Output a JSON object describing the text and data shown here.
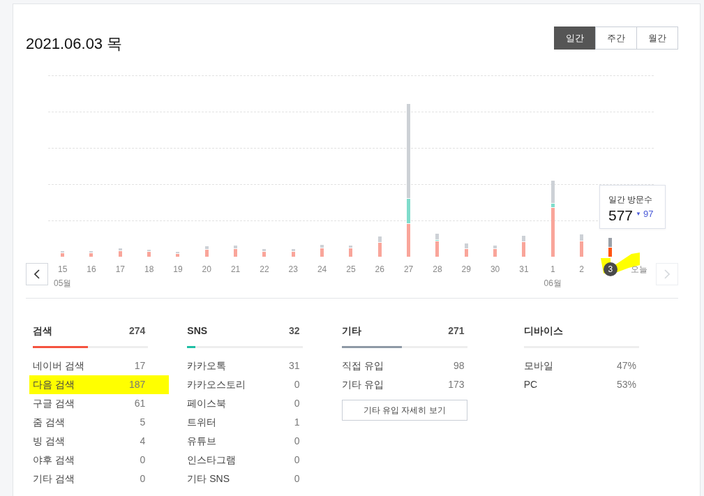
{
  "date_title": "2021.06.03 목",
  "period_tabs": [
    {
      "label": "일간",
      "selected": true
    },
    {
      "label": "주간",
      "selected": false
    },
    {
      "label": "월간",
      "selected": false
    }
  ],
  "chart": {
    "prev": {
      "disabled": false
    },
    "next": {
      "disabled": true
    },
    "days": [
      {
        "label": "15",
        "month": "05월",
        "selected": false,
        "highlighted": false
      },
      {
        "label": "16",
        "selected": false,
        "highlighted": false
      },
      {
        "label": "17",
        "selected": false,
        "highlighted": false
      },
      {
        "label": "18",
        "selected": false,
        "highlighted": false
      },
      {
        "label": "19",
        "selected": false,
        "highlighted": false
      },
      {
        "label": "20",
        "selected": false,
        "highlighted": false
      },
      {
        "label": "21",
        "selected": false,
        "highlighted": false
      },
      {
        "label": "22",
        "selected": false,
        "highlighted": false
      },
      {
        "label": "23",
        "selected": false,
        "highlighted": false
      },
      {
        "label": "24",
        "selected": false,
        "highlighted": false
      },
      {
        "label": "25",
        "selected": false,
        "highlighted": false
      },
      {
        "label": "26",
        "selected": false,
        "highlighted": false
      },
      {
        "label": "27",
        "selected": false,
        "highlighted": false
      },
      {
        "label": "28",
        "selected": false,
        "highlighted": false
      },
      {
        "label": "29",
        "selected": false,
        "highlighted": false
      },
      {
        "label": "30",
        "selected": false,
        "highlighted": false
      },
      {
        "label": "31",
        "selected": false,
        "highlighted": false
      },
      {
        "label": "1",
        "month": "06월",
        "selected": false,
        "highlighted": false
      },
      {
        "label": "2",
        "selected": false,
        "highlighted": false
      },
      {
        "label": "3",
        "selected": true,
        "highlighted": true
      },
      {
        "label": "오늘",
        "selected": false,
        "highlighted": false
      }
    ],
    "tooltip": {
      "title": "일간 방문수",
      "value": "577",
      "change_marker": "▼",
      "change": "97"
    }
  },
  "stats": [
    {
      "title": "검색",
      "total": "274",
      "color": "#f4533f",
      "level": 0.48,
      "rows": [
        {
          "label": "네이버 검색",
          "value": "17",
          "highlighted": false
        },
        {
          "label": "다음 검색",
          "value": "187",
          "highlighted": true
        },
        {
          "label": "구글 검색",
          "value": "61",
          "highlighted": false
        },
        {
          "label": "줌 검색",
          "value": "5",
          "highlighted": false
        },
        {
          "label": "빙 검색",
          "value": "4",
          "highlighted": false
        },
        {
          "label": "야후 검색",
          "value": "0",
          "highlighted": false
        },
        {
          "label": "기타 검색",
          "value": "0",
          "highlighted": false
        }
      ]
    },
    {
      "title": "SNS",
      "total": "32",
      "color": "#1fbfa5",
      "level": 0.07,
      "rows": [
        {
          "label": "카카오톡",
          "value": "31",
          "highlighted": false
        },
        {
          "label": "카카오스토리",
          "value": "0",
          "highlighted": false
        },
        {
          "label": "페이스북",
          "value": "0",
          "highlighted": false
        },
        {
          "label": "트위터",
          "value": "1",
          "highlighted": false
        },
        {
          "label": "유튜브",
          "value": "0",
          "highlighted": false
        },
        {
          "label": "인스타그램",
          "value": "0",
          "highlighted": false
        },
        {
          "label": "기타 SNS",
          "value": "0",
          "highlighted": false
        }
      ]
    },
    {
      "title": "기타",
      "total": "271",
      "color": "#8e99a6",
      "level": 0.48,
      "rows": [
        {
          "label": "직접 유입",
          "value": "98",
          "highlighted": false
        },
        {
          "label": "기타 유입",
          "value": "173",
          "highlighted": false
        }
      ],
      "button": "기타 유입 자세히 보기"
    },
    {
      "title": "디바이스",
      "rows": [
        {
          "label": "모바일",
          "value": "47%",
          "highlighted": false
        },
        {
          "label": "PC",
          "value": "53%",
          "highlighted": false
        }
      ]
    }
  ]
}
